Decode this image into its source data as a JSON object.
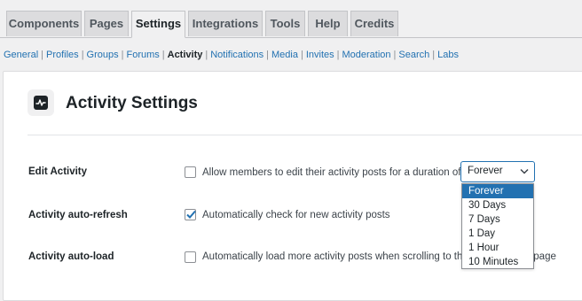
{
  "tabs": [
    {
      "label": "Components"
    },
    {
      "label": "Pages"
    },
    {
      "label": "Settings",
      "active": true
    },
    {
      "label": "Integrations"
    },
    {
      "label": "Tools"
    },
    {
      "label": "Help"
    },
    {
      "label": "Credits"
    }
  ],
  "subnav": {
    "items": [
      "General",
      "Profiles",
      "Groups",
      "Forums",
      "Activity",
      "Notifications",
      "Media",
      "Invites",
      "Moderation",
      "Search",
      "Labs"
    ],
    "current": "Activity"
  },
  "section": {
    "icon": "activity-icon",
    "title": "Activity Settings"
  },
  "settings": {
    "edit_activity": {
      "label": "Edit Activity",
      "text": "Allow members to edit their activity posts for a duration of",
      "checked": false,
      "select_value": "Forever",
      "options": [
        "Forever",
        "30 Days",
        "7 Days",
        "1 Day",
        "1 Hour",
        "10 Minutes"
      ]
    },
    "auto_refresh": {
      "label": "Activity auto-refresh",
      "text": "Automatically check for new activity posts",
      "checked": true
    },
    "auto_load": {
      "label": "Activity auto-load",
      "text": "Automatically load more activity posts when scrolling to the bottom of the page",
      "checked": false
    }
  },
  "colors": {
    "accent": "#2271b1",
    "background": "#f0f0f1",
    "text": "#1d2327"
  }
}
